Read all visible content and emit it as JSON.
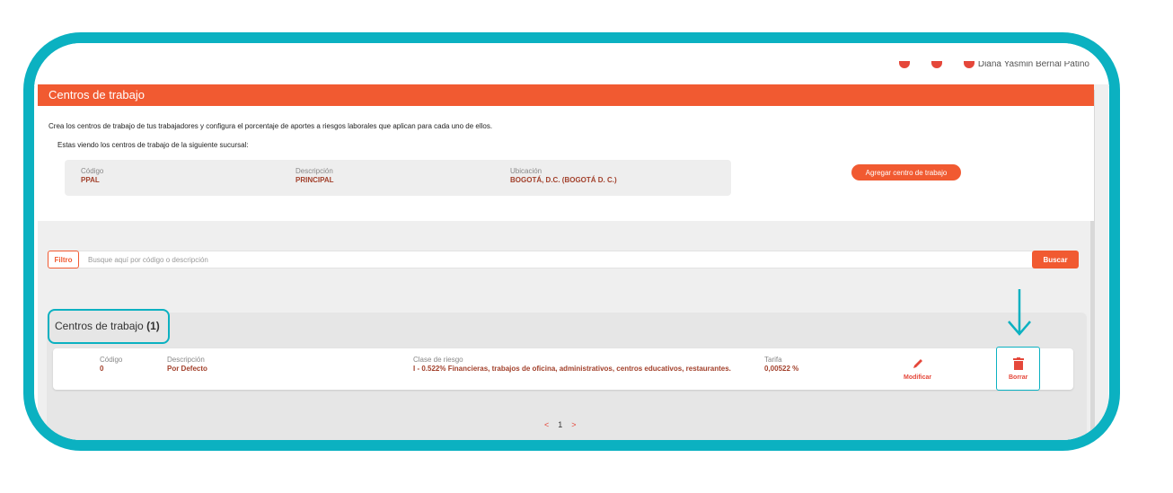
{
  "header": {
    "title": "Centros de trabajo"
  },
  "topbar": {
    "user_name": "Diana Yasmin Bernal Patiño"
  },
  "intro": {
    "text": "Crea los centros de trabajo de tus trabajadores y configura el porcentaje de aportes a riesgos laborales que aplican para cada uno de ellos.",
    "branch_text": "Estas viendo los centros de trabajo de la siguiente sucursal:"
  },
  "branch": {
    "code_label": "Código",
    "code_value": "PPAL",
    "desc_label": "Descripción",
    "desc_value": "PRINCIPAL",
    "loc_label": "Ubicación",
    "loc_value": "BOGOTÁ, D.C. (BOGOTÁ D. C.)"
  },
  "add_button": "Agregar centro de trabajo",
  "filter": {
    "label": "Filtro",
    "placeholder": "Busque aquí por código o descripción",
    "search_button": "Buscar"
  },
  "list": {
    "title": "Centros de trabajo",
    "count": "(1)",
    "rows": [
      {
        "code_label": "Código",
        "code_value": "0",
        "desc_label": "Descripción",
        "desc_value": "Por Defecto",
        "risk_label": "Clase de riesgo",
        "risk_value": "I - 0.522% Financieras, trabajos de oficina, administrativos, centros educativos, restaurantes.",
        "rate_label": "Tarifa",
        "rate_value": "0,00522 %",
        "modify_label": "Modificar",
        "delete_label": "Borrar"
      }
    ]
  },
  "pager": {
    "prev": "<",
    "page": "1",
    "next": ">"
  },
  "colors": {
    "accent": "#f15a31",
    "highlight": "#0bb1c1",
    "value_text": "#a2402b"
  }
}
